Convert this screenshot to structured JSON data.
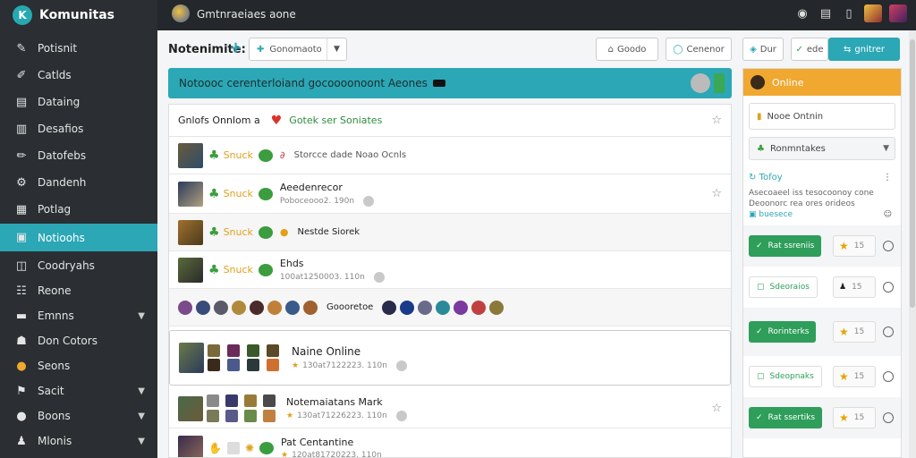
{
  "app": {
    "name": "Komunitas",
    "page_title": "Gmtnraeiaes aone"
  },
  "sidebar": {
    "items": [
      {
        "label": "Potisnit",
        "icon": "edit-icon"
      },
      {
        "label": "Catlds",
        "icon": "pencil-icon"
      },
      {
        "label": "Dataing",
        "icon": "document-icon"
      },
      {
        "label": "Desafios",
        "icon": "document-icon"
      },
      {
        "label": "Datofebs",
        "icon": "pin-icon"
      },
      {
        "label": "Dandenh",
        "icon": "gear-icon"
      },
      {
        "label": "Potlag",
        "icon": "calendar-icon"
      },
      {
        "label": "Notioohs",
        "icon": "inbox-icon",
        "active": true
      },
      {
        "label": "Coodryahs",
        "icon": "chat-icon"
      },
      {
        "label": "Reone",
        "icon": "grid-icon"
      },
      {
        "label": "Emnns",
        "icon": "folder-icon",
        "chevron": true
      },
      {
        "label": "Don Cotors",
        "icon": "people-icon"
      },
      {
        "label": "Seons",
        "icon": "emoji-icon"
      },
      {
        "label": "Sacit",
        "icon": "flag-icon",
        "chevron": true
      },
      {
        "label": "Boons",
        "icon": "circle-icon",
        "chevron": true
      },
      {
        "label": "Mlonis",
        "icon": "person-icon",
        "chevron": true
      }
    ]
  },
  "toolbar": {
    "title": "Notenimite:",
    "select_value": "Gonomaoto",
    "btn_goodo": "Goodo",
    "btn_cenenor": "Cenenor",
    "btn_dur": "Dur",
    "btn_ede": "ede",
    "btn_gnitrer": "gnitrer"
  },
  "banner": {
    "text": "Notoooc cerenterloiand gocoooonoont Aeones"
  },
  "list": {
    "header": {
      "text": "Gnlofs Onnlom a",
      "green": "Gotek ser Soniates"
    },
    "rows": [
      {
        "type": "simple",
        "snack": "Snuck",
        "text": "Storcce dade Noao Ocnls"
      },
      {
        "type": "two",
        "snack": "Snuck",
        "title": "Aeedenrecor",
        "sub": "Poboceooo2. 190n"
      },
      {
        "type": "simple",
        "snack": "Snuck",
        "text": "Nestde Siorek"
      },
      {
        "type": "two",
        "snack": "Snuck",
        "title": "Ehds",
        "sub": "100at1250003. 110n"
      },
      {
        "type": "avatars",
        "text": "Goooretoe"
      },
      {
        "type": "card",
        "title": "Naine Online",
        "sub": "130at7122223. 110n"
      },
      {
        "type": "two",
        "title": "Notemaiatans Mark",
        "sub": "130at71226223. 110n"
      },
      {
        "type": "two",
        "title": "Pat Centantine",
        "sub": "120at81720223. 110n"
      }
    ]
  },
  "rpanel": {
    "online_label": "Online",
    "search_placeholder": "Nooe Ontnin",
    "select_value": "Ronmntakes",
    "status": "Tofoy",
    "desc1": "Asecoaeel iss tesocoonoy cone",
    "desc2": "Deoonorc rea ores orideos",
    "desc_link": "buesece",
    "rows": [
      {
        "label": "Rat ssreniis",
        "count": "15",
        "style": "green"
      },
      {
        "label": "Sdeoraios",
        "count": "15",
        "style": "light"
      },
      {
        "label": "Rorinterks",
        "count": "15",
        "style": "green"
      },
      {
        "label": "Sdeopnaks",
        "count": "15",
        "style": "light"
      },
      {
        "label": "Rat ssertiks",
        "count": "15",
        "style": "green"
      }
    ]
  },
  "colors": {
    "accent": "#2ba7b5",
    "sidebar_bg": "#2b2f33",
    "online": "#f0a830",
    "green": "#2e9e5a"
  }
}
